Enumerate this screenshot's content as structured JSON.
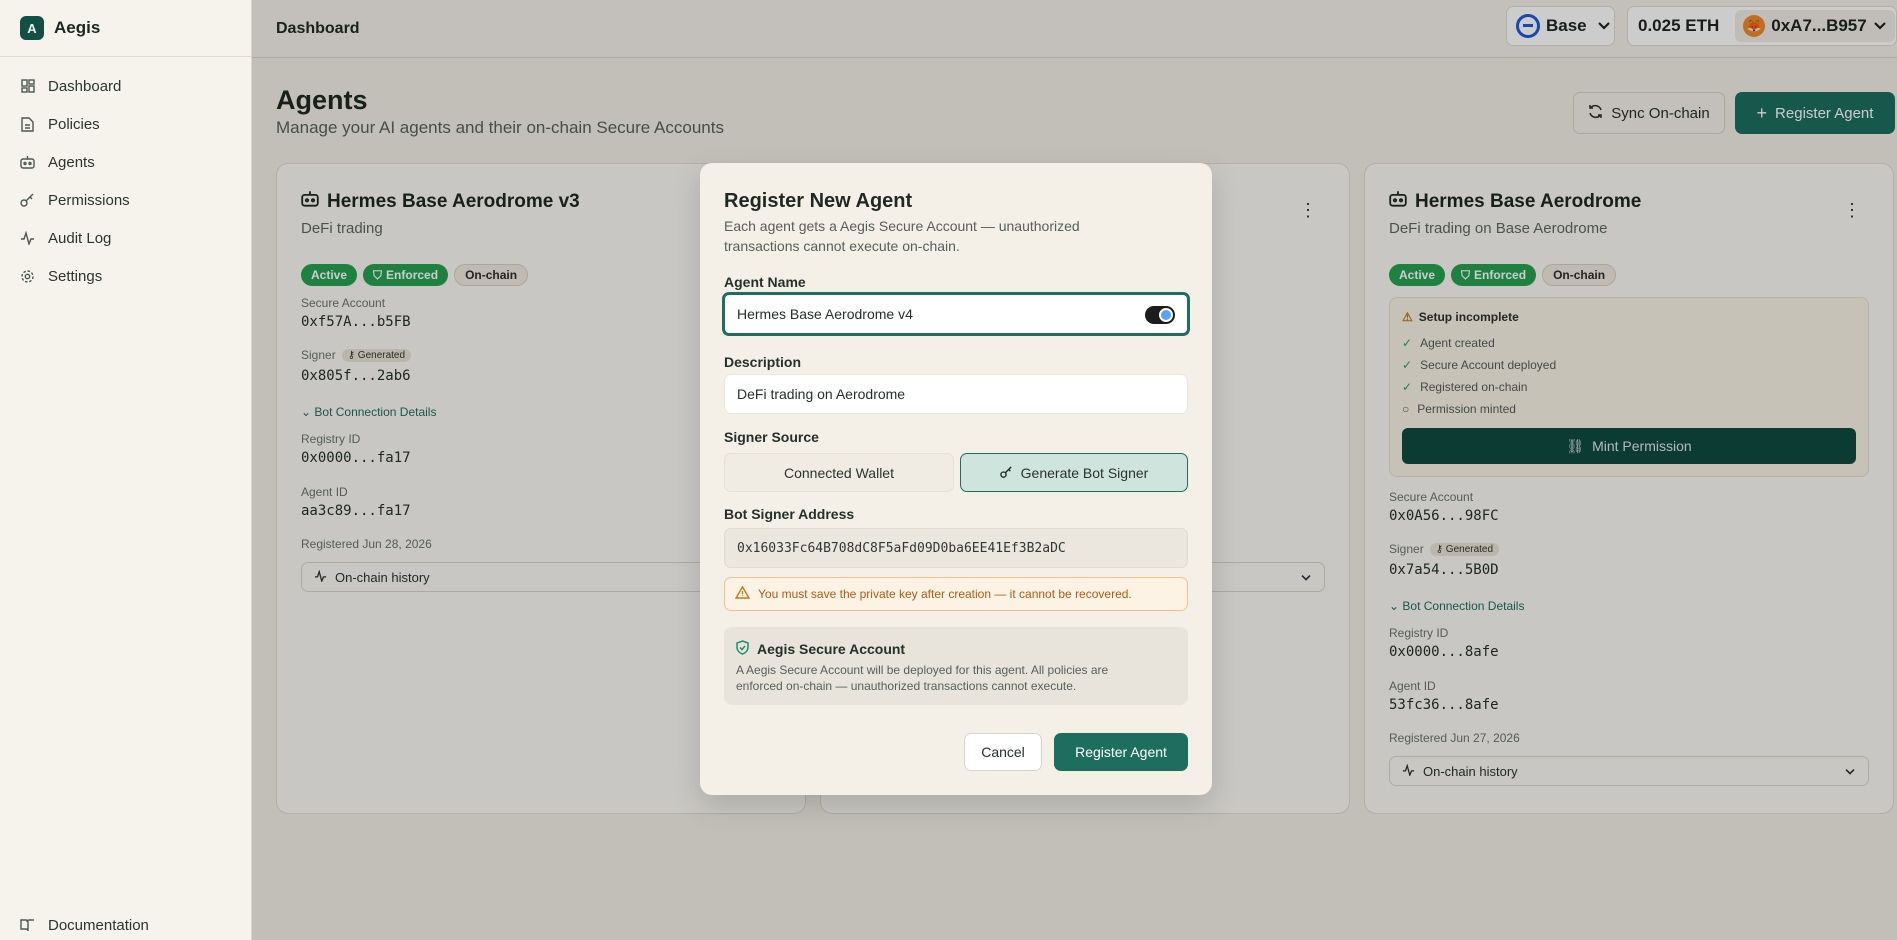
{
  "app": {
    "name": "Aegis",
    "logo_glyph": "A"
  },
  "sidebar": {
    "items": [
      {
        "label": "Dashboard",
        "icon": "grid-icon"
      },
      {
        "label": "Policies",
        "icon": "document-icon"
      },
      {
        "label": "Agents",
        "icon": "bot-icon"
      },
      {
        "label": "Permissions",
        "icon": "key-icon"
      },
      {
        "label": "Audit Log",
        "icon": "activity-icon"
      },
      {
        "label": "Settings",
        "icon": "gear-icon"
      }
    ],
    "bottom": {
      "label": "Documentation",
      "icon": "book-icon"
    }
  },
  "topbar": {
    "title": "Dashboard",
    "network": "Base",
    "balance": "0.025 ETH",
    "address": "0xA7...B957"
  },
  "page": {
    "title": "Agents",
    "subtitle": "Manage your AI agents and their on-chain Secure Accounts",
    "sync_label": "Sync On-chain",
    "register_label": "Register Agent"
  },
  "cards": [
    {
      "name": "Hermes Base Aerodrome v3",
      "description": "DeFi trading",
      "badges": [
        "Active",
        "Enforced",
        "On-chain"
      ],
      "secure_account_label": "Secure Account",
      "secure_account": "0xf57A...b5FB",
      "signer_label": "Signer",
      "signer_tag": "Generated",
      "signer": "0x805f...2ab6",
      "bot_link": "Bot Connection Details",
      "registry_label": "Registry ID",
      "registry_id": "0x0000...fa17",
      "agent_id_label": "Agent ID",
      "agent_id": "aa3c89...fa17",
      "registered": "Registered Jun 28, 2026",
      "history": "On-chain history"
    },
    {
      "name": "Hermes Base Aerodrome",
      "description": "DeFi trading on Base Aerodrome",
      "badges": [
        "Active",
        "Enforced",
        "On-chain"
      ],
      "setup": {
        "title": "Setup incomplete",
        "steps": [
          "Agent created",
          "Secure Account deployed",
          "Registered on-chain",
          "Permission minted"
        ],
        "mint_label": "Mint Permission"
      },
      "secure_account_label": "Secure Account",
      "secure_account": "0x0A56...98FC",
      "signer_label": "Signer",
      "signer_tag": "Generated",
      "signer": "0x7a54...5B0D",
      "bot_link": "Bot Connection Details",
      "registry_label": "Registry ID",
      "registry_id": "0x0000...8afe",
      "agent_id_label": "Agent ID",
      "agent_id": "53fc36...8afe",
      "registered": "Registered Jun 27, 2026",
      "history": "On-chain history"
    }
  ],
  "modal": {
    "title": "Register New Agent",
    "subtitle": "Each agent gets a Aegis Secure Account — unauthorized transactions cannot execute on-chain.",
    "name_label": "Agent Name",
    "name_value": "Hermes Base Aerodrome v4",
    "desc_label": "Description",
    "desc_value": "DeFi trading on Aerodrome",
    "signer_source_label": "Signer Source",
    "option_connected": "Connected Wallet",
    "option_generate": "Generate Bot Signer",
    "bot_signer_label": "Bot Signer Address",
    "bot_signer_value": "0x16033Fc64B708dC8F5aFd09D0ba6EE41Ef3B2aDC",
    "warning": "You must save the private key after creation — it cannot be recovered.",
    "secure_title": "Aegis Secure Account",
    "secure_text": "A Aegis Secure Account will be deployed for this agent. All policies are enforced on-chain — unauthorized transactions cannot execute.",
    "cancel_label": "Cancel",
    "submit_label": "Register Agent"
  },
  "colors": {
    "accent": "#1e6e5f",
    "badge_green": "#26a253",
    "warning": "#b25a14"
  }
}
